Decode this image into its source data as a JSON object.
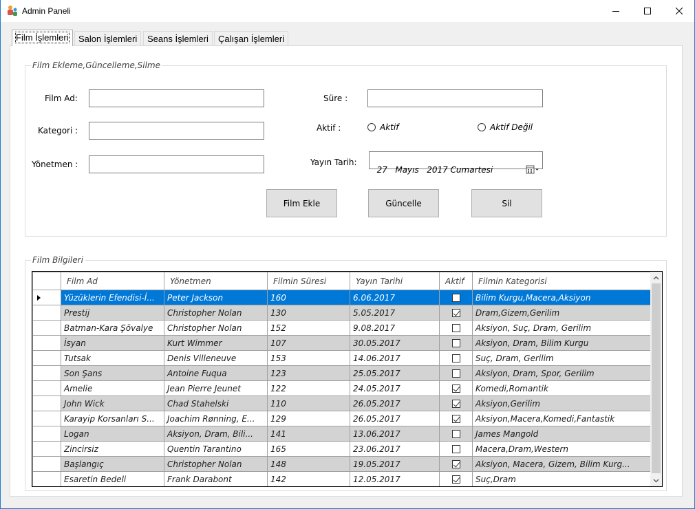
{
  "window": {
    "title": "Admin Paneli"
  },
  "tabs": [
    {
      "label": "Film İşlemleri"
    },
    {
      "label": "Salon İşlemleri"
    },
    {
      "label": "Seans İşlemleri"
    },
    {
      "label": "Çalışan İşlemleri"
    }
  ],
  "film_form": {
    "group_title": "Film Ekleme,Güncelleme,Silme",
    "film_ad_label": "Film Ad:",
    "kategori_label": "Kategori :",
    "yonetmen_label": "Yönetmen :",
    "sure_label": "Süre :",
    "aktif_label": "Aktif :",
    "radio_aktif": "Aktif",
    "radio_aktif_degil": "Aktif Değil",
    "yayin_tarih_label": "Yayın Tarih:",
    "yayin_tarih_value": "27   Mayıs   2017 Cumartesi",
    "film_ad_value": "",
    "kategori_value": "",
    "yonetmen_value": "",
    "sure_value": "",
    "btn_film_ekle": "Film Ekle",
    "btn_guncelle": "Güncelle",
    "btn_sil": "Sil"
  },
  "film_list": {
    "group_title": "Film Bilgileri",
    "columns": [
      "Film Ad",
      "Yönetmen",
      "Filmin Süresi",
      "Yayın Tarihi",
      "Aktif",
      "Filmin Kategorisi"
    ],
    "rows": [
      {
        "ad": "Yüzüklerin Efendisi-İ...",
        "yonetmen": "Peter Jackson",
        "sure": "160",
        "tarih": "6.06.2017",
        "aktif": false,
        "kategori": "Bilim Kurgu,Macera,Aksiyon"
      },
      {
        "ad": "Prestij",
        "yonetmen": "Christopher Nolan",
        "sure": "130",
        "tarih": "5.05.2017",
        "aktif": true,
        "kategori": "Dram,Gizem,Gerilim"
      },
      {
        "ad": "Batman-Kara Şövalye",
        "yonetmen": "Christopher Nolan",
        "sure": "152",
        "tarih": "9.08.2017",
        "aktif": false,
        "kategori": "Aksiyon, Suç, Dram, Gerilim"
      },
      {
        "ad": "İsyan",
        "yonetmen": "Kurt Wimmer",
        "sure": "107",
        "tarih": "30.05.2017",
        "aktif": false,
        "kategori": " Aksiyon, Dram, Bilim Kurgu"
      },
      {
        "ad": "Tutsak",
        "yonetmen": "Denis Villeneuve",
        "sure": "153",
        "tarih": "14.06.2017",
        "aktif": false,
        "kategori": "Suç, Dram, Gerilim"
      },
      {
        "ad": "Son Şans",
        "yonetmen": "Antoine Fuqua",
        "sure": "123",
        "tarih": "25.05.2017",
        "aktif": false,
        "kategori": "Aksiyon, Dram, Spor, Gerilim"
      },
      {
        "ad": "Amelie",
        "yonetmen": "Jean Pierre Jeunet",
        "sure": "122",
        "tarih": "24.05.2017",
        "aktif": true,
        "kategori": "Komedi,Romantik"
      },
      {
        "ad": "John Wick",
        "yonetmen": "Chad Stahelski",
        "sure": "110",
        "tarih": "26.05.2017",
        "aktif": true,
        "kategori": "Aksiyon,Gerilim"
      },
      {
        "ad": "Karayip Korsanları S...",
        "yonetmen": "Joachim Rønning, E...",
        "sure": "129",
        "tarih": "26.05.2017",
        "aktif": true,
        "kategori": "Aksiyon,Macera,Komedi,Fantastik"
      },
      {
        "ad": "Logan",
        "yonetmen": "Aksiyon, Dram, Bili...",
        "sure": "141",
        "tarih": "13.06.2017",
        "aktif": false,
        "kategori": "James Mangold"
      },
      {
        "ad": "Zincirsiz",
        "yonetmen": "Quentin Tarantino",
        "sure": "165",
        "tarih": "23.06.2017",
        "aktif": false,
        "kategori": "Macera,Dram,Western"
      },
      {
        "ad": "Başlangıç",
        "yonetmen": "Christopher Nolan",
        "sure": "148",
        "tarih": "19.05.2017",
        "aktif": true,
        "kategori": "Aksiyon, Macera, Gizem, Bilim Kurg..."
      },
      {
        "ad": "Esaretin Bedeli",
        "yonetmen": "Frank Darabont",
        "sure": "142",
        "tarih": "12.05.2017",
        "aktif": true,
        "kategori": "Suç,Dram"
      }
    ]
  }
}
